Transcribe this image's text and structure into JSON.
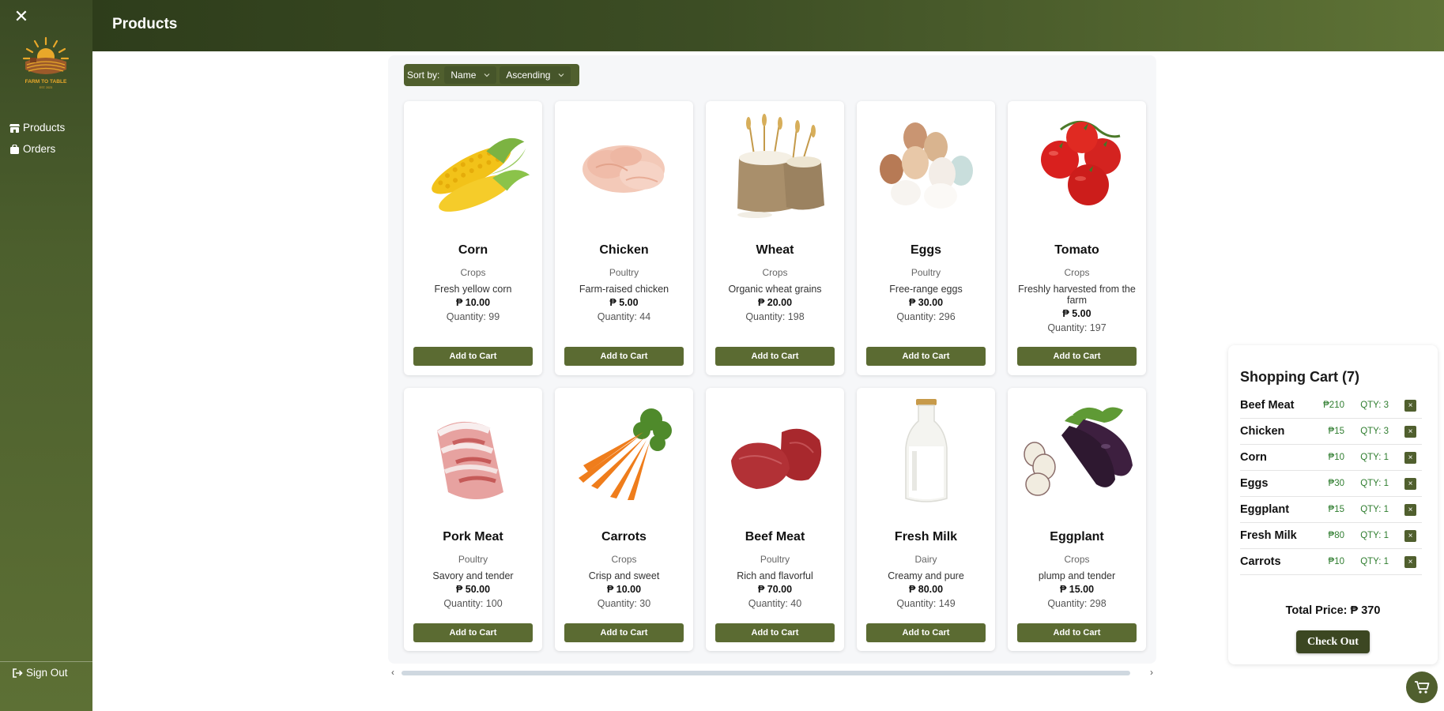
{
  "header": {
    "title": "Products"
  },
  "sidebar": {
    "close_icon": "close-icon",
    "logo": {
      "line1": "FARM TO TABLE",
      "line2": "EST. 2023"
    },
    "items": [
      {
        "label": "Products",
        "icon": "store-icon"
      },
      {
        "label": "Orders",
        "icon": "bag-icon"
      }
    ],
    "signout": {
      "label": "Sign Out",
      "icon": "sign-out-icon"
    }
  },
  "sort": {
    "label": "Sort by:",
    "field": "Name",
    "order": "Ascending"
  },
  "products": [
    {
      "name": "Corn",
      "category": "Crops",
      "description": "Fresh yellow corn",
      "price": "₱ 10.00",
      "quantity": "Quantity: 99",
      "button": "Add to Cart",
      "image": "corn"
    },
    {
      "name": "Chicken",
      "category": "Poultry",
      "description": "Farm-raised chicken",
      "price": "₱ 5.00",
      "quantity": "Quantity: 44",
      "button": "Add to Cart",
      "image": "chicken"
    },
    {
      "name": "Wheat",
      "category": "Crops",
      "description": "Organic wheat grains",
      "price": "₱ 20.00",
      "quantity": "Quantity: 198",
      "button": "Add to Cart",
      "image": "wheat"
    },
    {
      "name": "Eggs",
      "category": "Poultry",
      "description": "Free-range eggs",
      "price": "₱ 30.00",
      "quantity": "Quantity: 296",
      "button": "Add to Cart",
      "image": "eggs"
    },
    {
      "name": "Tomato",
      "category": "Crops",
      "description": "Freshly harvested from the farm",
      "price": "₱ 5.00",
      "quantity": "Quantity: 197",
      "button": "Add to Cart",
      "image": "tomato"
    },
    {
      "name": "Pork Meat",
      "category": "Poultry",
      "description": "Savory and tender",
      "price": "₱ 50.00",
      "quantity": "Quantity: 100",
      "button": "Add to Cart",
      "image": "pork"
    },
    {
      "name": "Carrots",
      "category": "Crops",
      "description": "Crisp and sweet",
      "price": "₱ 10.00",
      "quantity": "Quantity: 30",
      "button": "Add to Cart",
      "image": "carrots"
    },
    {
      "name": "Beef Meat",
      "category": "Poultry",
      "description": "Rich and flavorful",
      "price": "₱ 70.00",
      "quantity": "Quantity: 40",
      "button": "Add to Cart",
      "image": "beef"
    },
    {
      "name": "Fresh Milk",
      "category": "Dairy",
      "description": "Creamy and pure",
      "price": "₱ 80.00",
      "quantity": "Quantity: 149",
      "button": "Add to Cart",
      "image": "milk"
    },
    {
      "name": "Eggplant",
      "category": "Crops",
      "description": "plump and tender",
      "price": "₱ 15.00",
      "quantity": "Quantity: 298",
      "button": "Add to Cart",
      "image": "eggplant"
    }
  ],
  "cart": {
    "title": "Shopping Cart (7)",
    "items": [
      {
        "name": "Beef Meat",
        "price": "₱210",
        "qty": "QTY: 3",
        "remove": "×"
      },
      {
        "name": "Chicken",
        "price": "₱15",
        "qty": "QTY: 3",
        "remove": "×"
      },
      {
        "name": "Corn",
        "price": "₱10",
        "qty": "QTY: 1",
        "remove": "×"
      },
      {
        "name": "Eggs",
        "price": "₱30",
        "qty": "QTY: 1",
        "remove": "×"
      },
      {
        "name": "Eggplant",
        "price": "₱15",
        "qty": "QTY: 1",
        "remove": "×"
      },
      {
        "name": "Fresh Milk",
        "price": "₱80",
        "qty": "QTY: 1",
        "remove": "×"
      },
      {
        "name": "Carrots",
        "price": "₱10",
        "qty": "QTY: 1",
        "remove": "×"
      }
    ],
    "total": "Total Price: ₱ 370",
    "checkout": "Check Out",
    "fab_icon": "cart-icon"
  },
  "colors": {
    "accent": "#5b6b32",
    "header_dark": "#2e3d1b",
    "price_green": "#2f7d2f"
  }
}
